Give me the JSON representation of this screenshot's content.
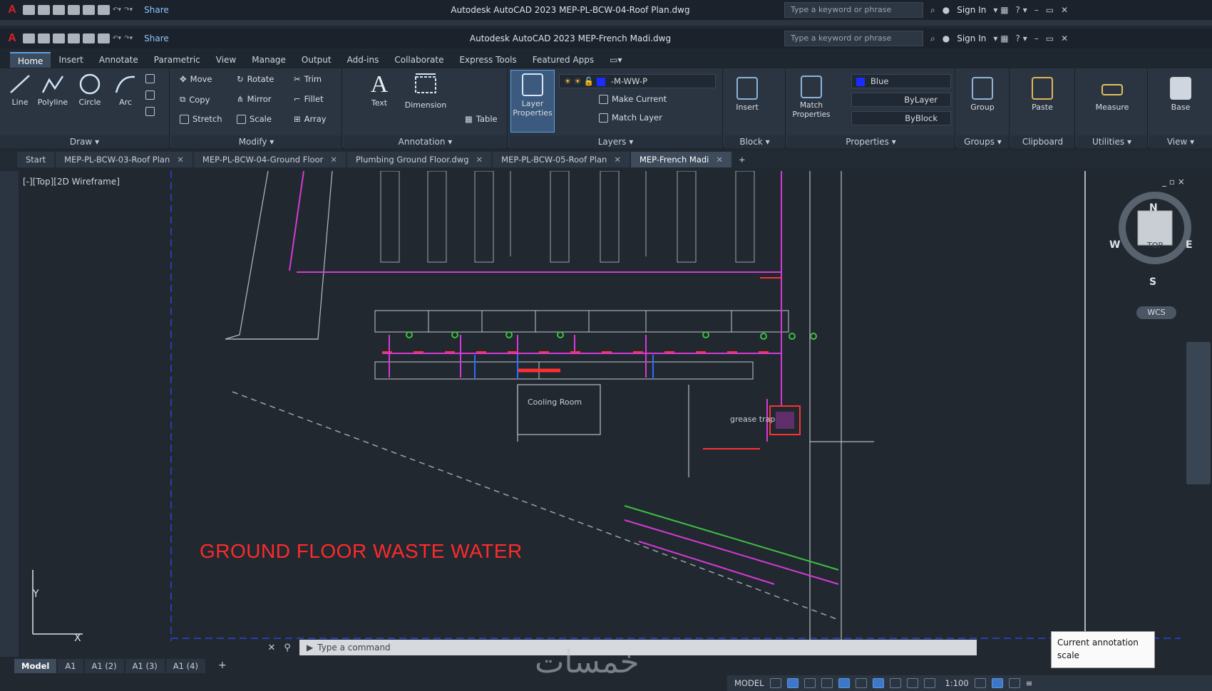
{
  "titlebar_back": {
    "share": "Share",
    "title": "Autodesk AutoCAD 2023  MEP-PL-BCW-04-Roof Plan.dwg",
    "search_placeholder": "Type a keyword or phrase",
    "sign_in": "Sign In"
  },
  "titlebar": {
    "share": "Share",
    "title": "Autodesk AutoCAD 2023   MEP-French Madi.dwg",
    "search_placeholder": "Type a keyword or phrase",
    "sign_in": "Sign In"
  },
  "ribbon_tabs": [
    "Home",
    "Insert",
    "Annotate",
    "Parametric",
    "View",
    "Manage",
    "Output",
    "Add-ins",
    "Collaborate",
    "Express Tools",
    "Featured Apps"
  ],
  "ribbon": {
    "draw": {
      "title": "Draw",
      "line": "Line",
      "polyline": "Polyline",
      "circle": "Circle",
      "arc": "Arc"
    },
    "modify": {
      "title": "Modify",
      "move": "Move",
      "rotate": "Rotate",
      "trim": "Trim",
      "copy": "Copy",
      "mirror": "Mirror",
      "fillet": "Fillet",
      "stretch": "Stretch",
      "scale": "Scale",
      "array": "Array"
    },
    "annotation": {
      "title": "Annotation",
      "text": "Text",
      "dimension": "Dimension",
      "table": "Table"
    },
    "layers": {
      "title": "Layers",
      "layer_properties": "Layer Properties",
      "current_layer": "-M-WW-P",
      "make_current": "Make Current",
      "match_layer": "Match Layer"
    },
    "block": {
      "title": "Block",
      "insert": "Insert"
    },
    "properties": {
      "title": "Properties",
      "match_properties": "Match Properties",
      "color": "Blue",
      "lineweight": "ByLayer",
      "linetype": "ByBlock"
    },
    "groups": {
      "title": "Groups",
      "group": "Group"
    },
    "utilities": {
      "title": "Utilities",
      "measure": "Measure"
    },
    "clipboard": {
      "title": "Clipboard",
      "paste": "Paste"
    },
    "view": {
      "title": "View",
      "base": "Base"
    }
  },
  "doc_tabs": [
    {
      "label": "Start",
      "active": false
    },
    {
      "label": "MEP-PL-BCW-03-Roof Plan",
      "active": false
    },
    {
      "label": "MEP-PL-BCW-04-Ground Floor",
      "active": false
    },
    {
      "label": "Plumbing Ground Floor.dwg",
      "active": false
    },
    {
      "label": "MEP-PL-BCW-05-Roof Plan",
      "active": false
    },
    {
      "label": "MEP-French Madi",
      "active": true
    }
  ],
  "viewport": {
    "label": "[-][Top][2D Wireframe]",
    "controls": "_ ▫ ×",
    "compass": {
      "n": "N",
      "s": "S",
      "e": "E",
      "w": "W",
      "top": "TOP"
    },
    "wcs": "WCS",
    "axis_y": "Y",
    "axis_x": "X"
  },
  "drawing": {
    "title": "GROUND FLOOR WASTE WATER",
    "room_label": "Cooling Room",
    "grease_label": "grease trap"
  },
  "command_line": {
    "placeholder": "Type a command"
  },
  "layout_tabs": [
    "Model",
    "A1",
    "A1 (2)",
    "A1 (3)",
    "A1 (4)"
  ],
  "status_bar": {
    "model": "MODEL",
    "scale": "1:100"
  },
  "tooltip": {
    "line1": "Current annotation",
    "line2": "scale"
  },
  "watermark": "خمسات"
}
